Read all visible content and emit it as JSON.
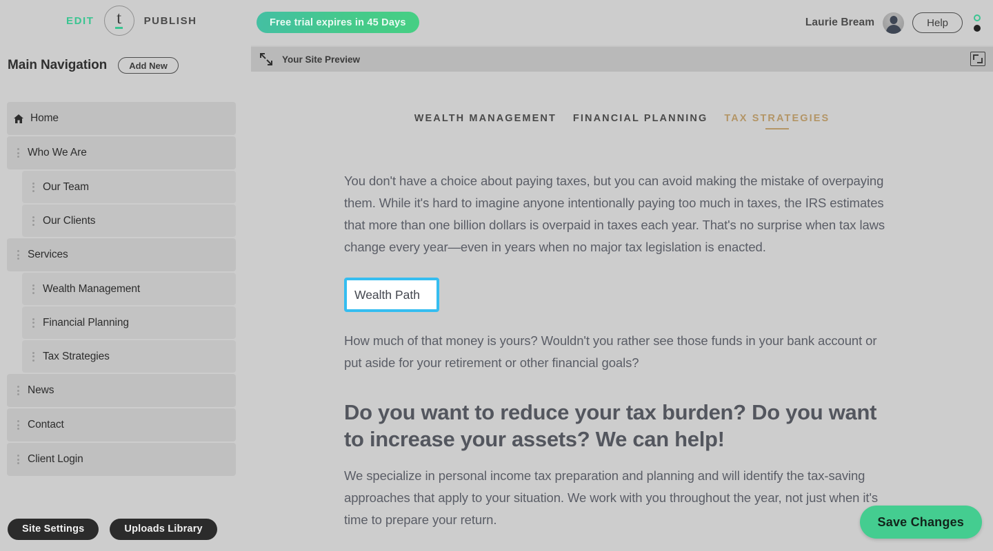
{
  "topbar": {
    "edit_label": "EDIT",
    "publish_label": "PUBLISH",
    "logo_glyph": "t",
    "trial_notice": "Free trial expires in 45 Days",
    "user_name": "Laurie Bream",
    "help_label": "Help",
    "accent_green": "#3ac491",
    "indicator_ring_color": "#3ac491",
    "indicator_dot_color": "#222222"
  },
  "sidebar": {
    "title": "Main Navigation",
    "add_new_label": "Add New",
    "items": [
      {
        "label": "Home",
        "icon": "home-icon",
        "level": 0
      },
      {
        "label": "Who We Are",
        "icon": "drag-handle-icon",
        "level": 0
      },
      {
        "label": "Our Team",
        "icon": "drag-handle-icon",
        "level": 1
      },
      {
        "label": "Our Clients",
        "icon": "drag-handle-icon",
        "level": 1
      },
      {
        "label": "Services",
        "icon": "drag-handle-icon",
        "level": 0
      },
      {
        "label": "Wealth Management",
        "icon": "drag-handle-icon",
        "level": 1
      },
      {
        "label": "Financial Planning",
        "icon": "drag-handle-icon",
        "level": 1
      },
      {
        "label": "Tax Strategies",
        "icon": "drag-handle-icon",
        "level": 1
      },
      {
        "label": "News",
        "icon": "drag-handle-icon",
        "level": 0
      },
      {
        "label": "Contact",
        "icon": "drag-handle-icon",
        "level": 0
      },
      {
        "label": "Client Login",
        "icon": "drag-handle-icon",
        "level": 0
      }
    ],
    "footer": {
      "site_settings_label": "Site Settings",
      "uploads_library_label": "Uploads Library"
    }
  },
  "preview": {
    "bar_title": "Your Site Preview",
    "collapse_icon": "collapse-arrows-icon",
    "fullscreen_icon": "fullscreen-icon"
  },
  "site": {
    "nav_tabs": [
      {
        "label": "WEALTH MANAGEMENT",
        "active": false
      },
      {
        "label": "FINANCIAL PLANNING",
        "active": false
      },
      {
        "label": "TAX STRATEGIES",
        "active": true
      }
    ],
    "active_tab_color": "#b39566",
    "paragraph_1": "You don't have a choice about paying taxes, but you can avoid making the mistake of overpaying them. While it's hard to imagine anyone intentionally paying too much in taxes, the IRS estimates that more than one billion dollars is overpaid in taxes each year. That's no surprise when tax laws change every year—even in years when no major tax legislation is enacted.",
    "title_input": {
      "value": "Wealth Path",
      "placeholder": "Enter title",
      "focus_outline_color": "#35bdf0"
    },
    "paragraph_2": "How much of that money is yours? Wouldn't you rather see those funds in your bank account or put aside for your retirement or other financial goals?",
    "heading": "Do you want to reduce your tax burden? Do you want to increase your assets? We can help!",
    "paragraph_3": "We specialize in personal income tax preparation and planning and will identify the tax-saving approaches that apply to your situation. We work with you throughout the year, not just when it's time to prepare your return."
  },
  "actions": {
    "save_label": "Save Changes",
    "save_color": "#44cd90"
  }
}
